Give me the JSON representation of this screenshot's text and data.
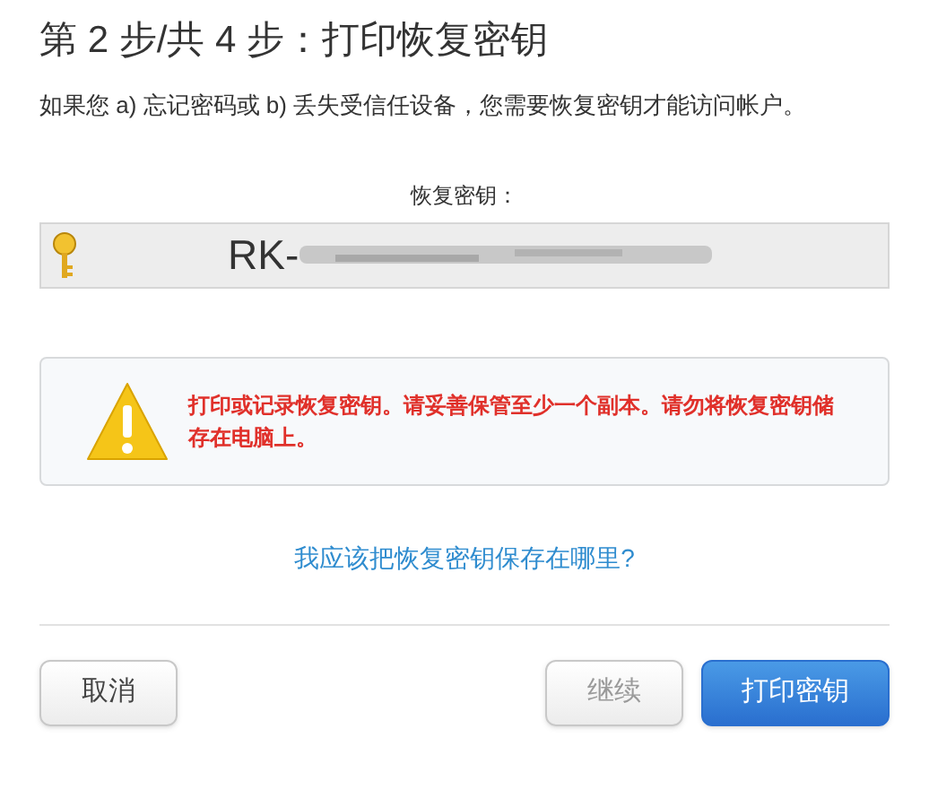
{
  "title": "第 2 步/共 4 步：打印恢复密钥",
  "description": "如果您 a) 忘记密码或 b) 丢失受信任设备，您需要恢复密钥才能访问帐户。",
  "key_label": "恢复密钥：",
  "key_value": "RK-",
  "warning": "打印或记录恢复密钥。请妥善保管至少一个副本。请勿将恢复密钥储存在电脑上。",
  "help_link": "我应该把恢复密钥保存在哪里?",
  "buttons": [
    {
      "label": "取消",
      "kind": "secondary",
      "disabled": false
    },
    {
      "label": "继续",
      "kind": "secondary",
      "disabled": true
    },
    {
      "label": "打印密钥",
      "kind": "primary",
      "disabled": false
    }
  ]
}
